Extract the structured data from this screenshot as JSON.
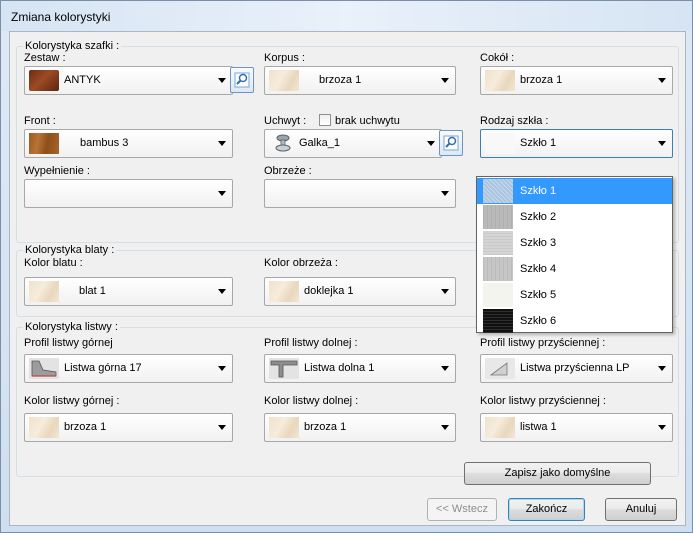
{
  "window": {
    "title": "Zmiana kolorystyki"
  },
  "group_szafki": {
    "title": "Kolorystyka szafki :",
    "zestaw": {
      "label": "Zestaw :",
      "value": "ANTYK"
    },
    "korpus": {
      "label": "Korpus :",
      "value": "brzoza 1"
    },
    "cokol": {
      "label": "Cokół :",
      "value": "brzoza 1"
    },
    "front": {
      "label": "Front :",
      "value": "bambus 3"
    },
    "uchwyt": {
      "label": "Uchwyt :",
      "checkbox_label": "brak uchwytu",
      "value": "Galka_1"
    },
    "rodzaj_szkla": {
      "label": "Rodzaj szkła :",
      "value": "Szkło 1"
    },
    "wypelnienie": {
      "label": "Wypełnienie :",
      "value": ""
    },
    "obrzeze": {
      "label": "Obrzeże :",
      "value": ""
    }
  },
  "group_blaty": {
    "title": "Kolorystyka blaty :",
    "kolor_blatu": {
      "label": "Kolor blatu :",
      "value": "blat 1"
    },
    "kolor_obrzeza": {
      "label": "Kolor obrzeża :",
      "value": "doklejka 1"
    }
  },
  "group_listwy": {
    "title": "Kolorystyka listwy :",
    "profil_gornej": {
      "label": "Profil listwy górnej",
      "value": "Listwa górna 17"
    },
    "profil_dolnej": {
      "label": "Profil listwy dolnej :",
      "value": "Listwa dolna 1"
    },
    "profil_przysciennej": {
      "label": "Profil listwy przyściennej :",
      "value": "Listwa przyścienna LP"
    },
    "kolor_gornej": {
      "label": "Kolor listwy górnej :",
      "value": "brzoza 1"
    },
    "kolor_dolnej": {
      "label": "Kolor listwy dolnej :",
      "value": "brzoza 1"
    },
    "kolor_przysciennej": {
      "label": "Kolor listwy przyściennej :",
      "value": "listwa 1"
    }
  },
  "dropdown": {
    "items": [
      {
        "label": "Szkło 1",
        "selected": true,
        "color": "#a9c4e0"
      },
      {
        "label": "Szkło 2",
        "selected": false,
        "color": "#b9b9b9"
      },
      {
        "label": "Szkło 3",
        "selected": false,
        "color": "#d4d4d4"
      },
      {
        "label": "Szkło 4",
        "selected": false,
        "color": "#c6c6c6"
      },
      {
        "label": "Szkło 5",
        "selected": false,
        "color": "#f4f4ee"
      },
      {
        "label": "Szkło 6",
        "selected": false,
        "color": "#111111"
      }
    ]
  },
  "buttons": {
    "save_default": "Zapisz jako domyślne",
    "back": "<< Wstecz",
    "finish": "Zakończ",
    "cancel": "Anuluj"
  },
  "colors": {
    "selection": "#3399ff",
    "focus_border": "#3c7fb1"
  }
}
